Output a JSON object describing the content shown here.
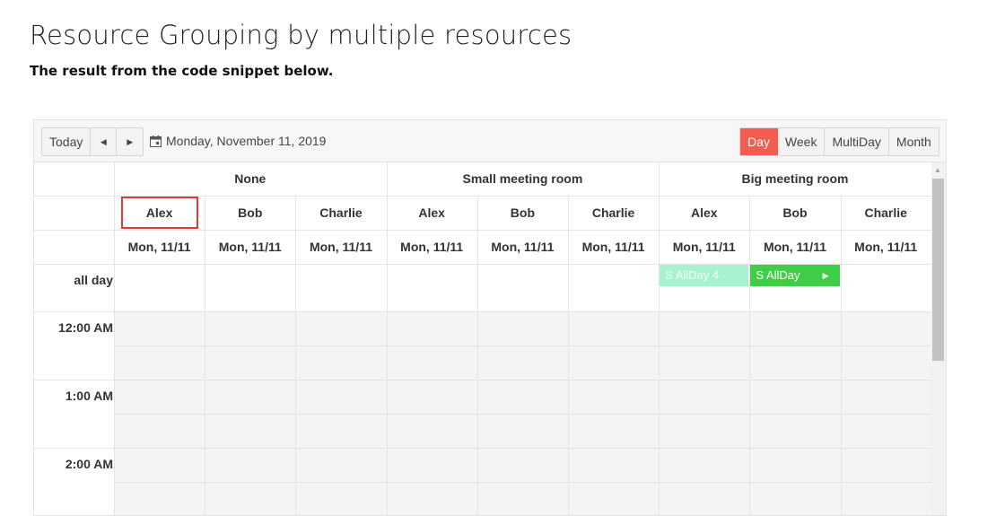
{
  "page": {
    "title": "Resource Grouping by multiple resources",
    "subtitle": "The result from the code snippet below."
  },
  "toolbar": {
    "today_label": "Today",
    "prev_icon": "◀",
    "next_icon": "▶",
    "date_text": "Monday, November 11, 2019",
    "views": [
      {
        "label": "Day",
        "active": true
      },
      {
        "label": "Week",
        "active": false
      },
      {
        "label": "MultiDay",
        "active": false
      },
      {
        "label": "Month",
        "active": false
      }
    ],
    "accent_color": "#f35c4f"
  },
  "groups": [
    {
      "name": "None"
    },
    {
      "name": "Small meeting room"
    },
    {
      "name": "Big meeting room"
    }
  ],
  "people": [
    "Alex",
    "Bob",
    "Charlie",
    "Alex",
    "Bob",
    "Charlie",
    "Alex",
    "Bob",
    "Charlie"
  ],
  "dates": [
    "Mon, 11/11",
    "Mon, 11/11",
    "Mon, 11/11",
    "Mon, 11/11",
    "Mon, 11/11",
    "Mon, 11/11",
    "Mon, 11/11",
    "Mon, 11/11",
    "Mon, 11/11"
  ],
  "allday_label": "all day",
  "times": [
    "12:00 AM",
    "1:00 AM",
    "2:00 AM"
  ],
  "events": [
    {
      "title": "S AllDay 4",
      "column": 6,
      "style": "light",
      "color": "#a7f3cf"
    },
    {
      "title": "S AllDay",
      "column": 7,
      "style": "green",
      "color": "#3fce47",
      "arrow": "▶"
    }
  ],
  "highlight_color": "#e03b3b"
}
